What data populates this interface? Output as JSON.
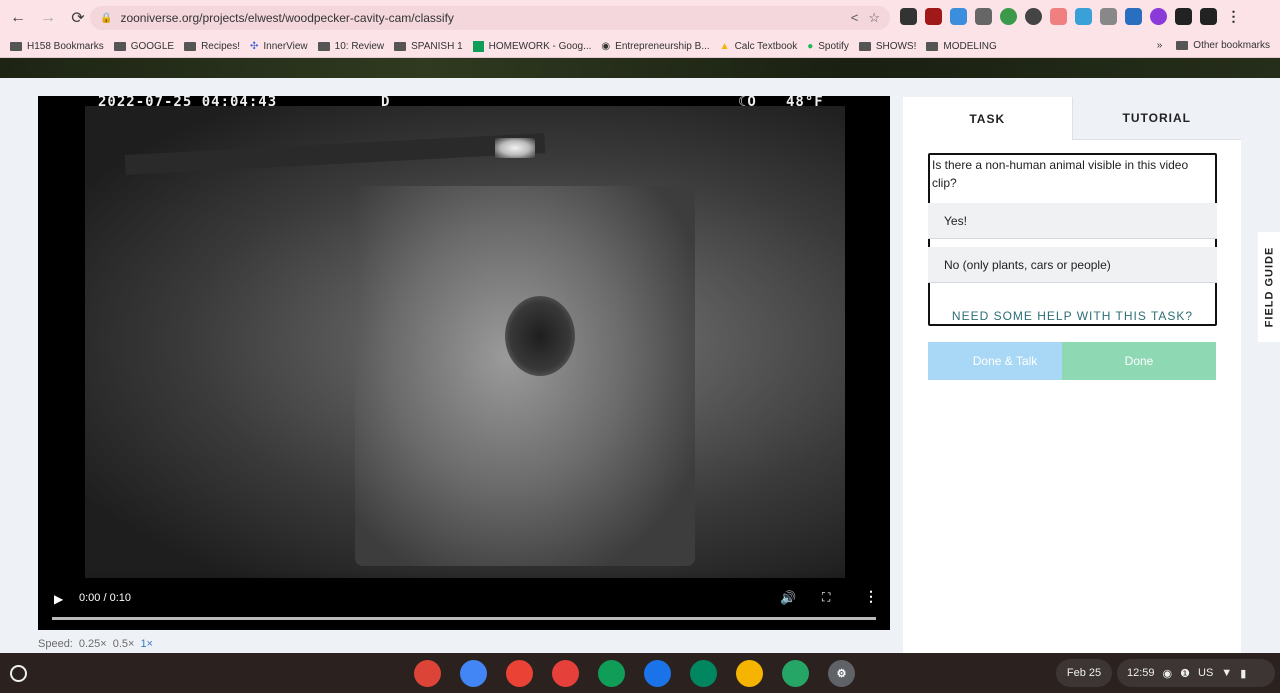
{
  "browser": {
    "url": "zooniverse.org/projects/elwest/woodpecker-cavity-cam/classify",
    "bookmarks": [
      "H158 Bookmarks",
      "GOOGLE",
      "Recipes!",
      "InnerView",
      "10: Review",
      "SPANISH 1",
      "HOMEWORK - Goog...",
      "Entrepreneurship B...",
      "Calc Textbook",
      "Spotify",
      "SHOWS!",
      "MODELING"
    ],
    "other_bookmarks": "Other bookmarks",
    "more_chevron": "»",
    "extensions": [
      {
        "icon": "home-ext-icon",
        "color": "#333"
      },
      {
        "icon": "ublock-ext-icon",
        "color": "#a01818"
      },
      {
        "icon": "download-ext-icon",
        "color": "#3a8edb"
      },
      {
        "icon": "r-ext-icon",
        "color": "#666"
      },
      {
        "icon": "grammar-ext-icon",
        "color": "#3a9a4a"
      },
      {
        "icon": "g-ext-icon",
        "color": "#444"
      },
      {
        "icon": "arrow-ext-icon",
        "color": "#f08080"
      },
      {
        "icon": "cloud-ext-icon",
        "color": "#3aa0d8"
      },
      {
        "icon": "cube-ext-icon",
        "color": "#888"
      },
      {
        "icon": "gear-ext-icon",
        "color": "#2a6fbf"
      },
      {
        "icon": "k-ext-icon",
        "color": "#8a3ad8"
      },
      {
        "icon": "puzzle-ext-icon",
        "color": "#222"
      },
      {
        "icon": "sidepanel-ext-icon",
        "color": "#222"
      },
      {
        "icon": "menu-ext-icon",
        "color": "#222"
      }
    ]
  },
  "video": {
    "timestamp": "2022-07-25 04:04:43",
    "flag": "D",
    "moon": "☾O",
    "temp": "48°F",
    "time": "0:00 / 0:10",
    "speed_label": "Speed:",
    "speeds": [
      "0.25×",
      "0.5×",
      "1×"
    ]
  },
  "task": {
    "tabs": [
      "TASK",
      "TUTORIAL"
    ],
    "question": "Is there a non-human animal visible in this video clip?",
    "answers": [
      "Yes!",
      "No (only plants, cars or people)"
    ],
    "help": "NEED SOME HELP WITH THIS TASK?",
    "done_talk": "Done & Talk",
    "done": "Done"
  },
  "field_guide": "FIELD GUIDE",
  "taskbar": {
    "apps": [
      {
        "name": "chrome-app-icon",
        "color": "#db4437"
      },
      {
        "name": "docs-app-icon",
        "color": "#4285f4"
      },
      {
        "name": "gmail-app-icon",
        "color": "#ea4335"
      },
      {
        "name": "canvas-app-icon",
        "color": "#e5413a"
      },
      {
        "name": "classroom-app-icon",
        "color": "#0f9d58"
      },
      {
        "name": "calendar-app-icon",
        "color": "#1a73e8"
      },
      {
        "name": "play-app-icon",
        "color": "#01875f"
      },
      {
        "name": "slides-app-icon",
        "color": "#f4b400"
      },
      {
        "name": "classroom2-app-icon",
        "color": "#25a667"
      },
      {
        "name": "settings-app-icon",
        "color": "#5f6368"
      }
    ],
    "date": "Feb 25",
    "clock": "12:59",
    "locale": "US"
  }
}
